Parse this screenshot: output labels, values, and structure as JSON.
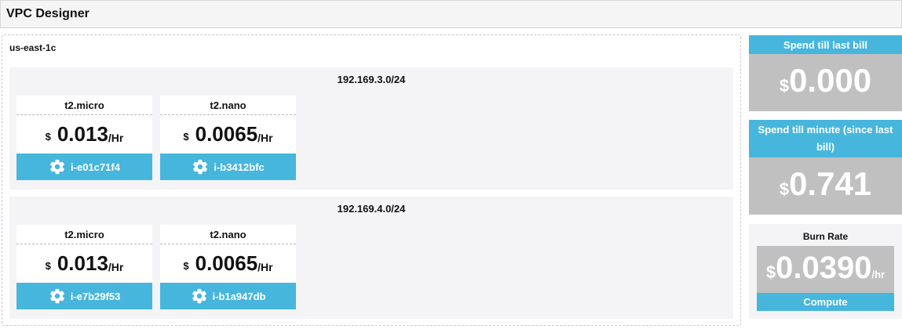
{
  "header": {
    "title": "VPC Designer"
  },
  "availability_zone": {
    "label": "us-east-1c"
  },
  "subnets": [
    {
      "cidr": "192.169.3.0/24",
      "instances": [
        {
          "type": "t2.micro",
          "currency": "$",
          "price": "0.013",
          "unit": "/Hr",
          "id": "i-e01c71f4"
        },
        {
          "type": "t2.nano",
          "currency": "$",
          "price": "0.0065",
          "unit": "/Hr",
          "id": "i-b3412bfc"
        }
      ]
    },
    {
      "cidr": "192.169.4.0/24",
      "instances": [
        {
          "type": "t2.micro",
          "currency": "$",
          "price": "0.013",
          "unit": "/Hr",
          "id": "i-e7b29f53"
        },
        {
          "type": "t2.nano",
          "currency": "$",
          "price": "0.0065",
          "unit": "/Hr",
          "id": "i-b1a947db"
        }
      ]
    }
  ],
  "spend_last_bill": {
    "title": "Spend till last bill",
    "currency": "$",
    "value": "0.000"
  },
  "spend_till_minute": {
    "title": "Spend till minute (since last bill)",
    "currency": "$",
    "value": "0.741"
  },
  "burn_rate": {
    "title": "Burn Rate",
    "currency": "$",
    "value": "0.0390",
    "unit": "/hr",
    "category": "Compute"
  },
  "colors": {
    "accent": "#47b6dc",
    "card_gray": "#c0c0c0",
    "panel_bg": "#f4f4f6"
  },
  "icons": {
    "instance_settings": "gear-icon"
  }
}
